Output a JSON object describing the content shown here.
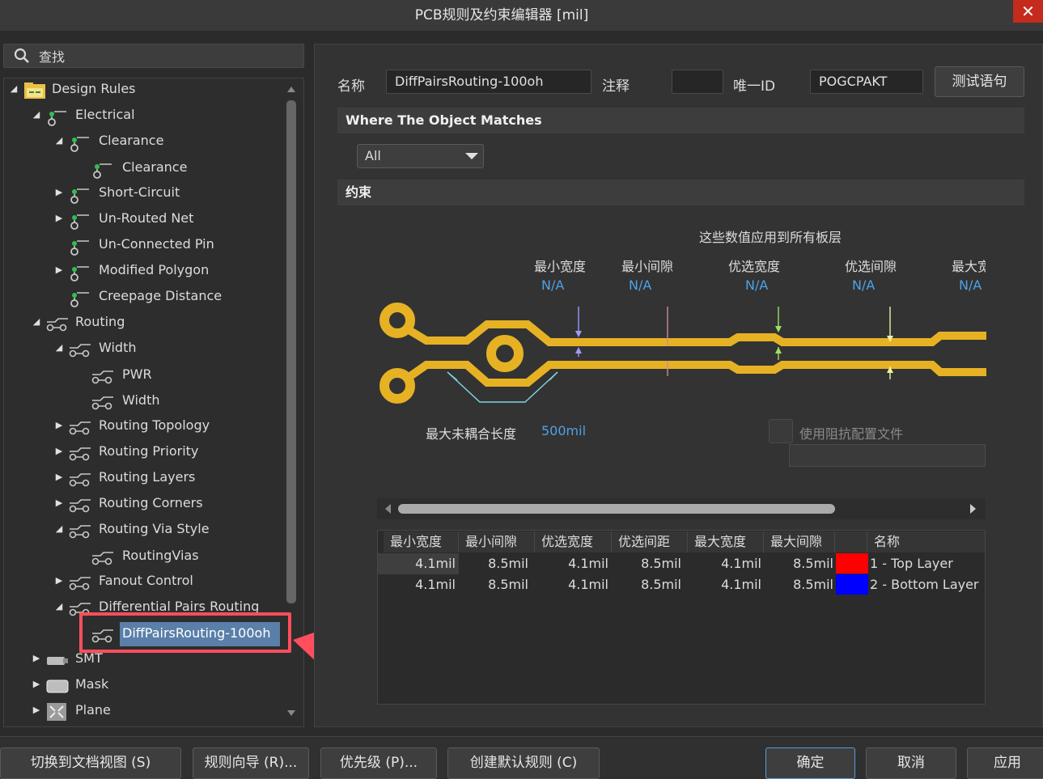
{
  "window": {
    "title": "PCB规则及约束编辑器 [mil]",
    "close_glyph": "✕"
  },
  "search": {
    "label": "查找"
  },
  "tree": {
    "items": [
      {
        "label": "Design Rules",
        "arrow": "◢",
        "icon": "design-rules-folder-icon"
      },
      {
        "label": "Electrical",
        "arrow": "◢",
        "icon": "electrical-rule-icon"
      },
      {
        "label": "Clearance",
        "arrow": "◢",
        "icon": "electrical-rule-icon"
      },
      {
        "label": "Clearance",
        "arrow": "",
        "icon": "electrical-rule-icon"
      },
      {
        "label": "Short-Circuit",
        "arrow": "▶",
        "icon": "electrical-rule-icon"
      },
      {
        "label": "Un-Routed Net",
        "arrow": "▶",
        "icon": "electrical-rule-icon"
      },
      {
        "label": "Un-Connected Pin",
        "arrow": "",
        "icon": "electrical-rule-icon"
      },
      {
        "label": "Modified Polygon",
        "arrow": "▶",
        "icon": "electrical-rule-icon"
      },
      {
        "label": "Creepage Distance",
        "arrow": "",
        "icon": "electrical-rule-icon"
      },
      {
        "label": "Routing",
        "arrow": "◢",
        "icon": "routing-rule-icon"
      },
      {
        "label": "Width",
        "arrow": "◢",
        "icon": "routing-rule-icon"
      },
      {
        "label": "PWR",
        "arrow": "",
        "icon": "routing-rule-icon"
      },
      {
        "label": "Width",
        "arrow": "",
        "icon": "routing-rule-icon"
      },
      {
        "label": "Routing Topology",
        "arrow": "▶",
        "icon": "routing-rule-icon"
      },
      {
        "label": "Routing Priority",
        "arrow": "▶",
        "icon": "routing-rule-icon"
      },
      {
        "label": "Routing Layers",
        "arrow": "▶",
        "icon": "routing-rule-icon"
      },
      {
        "label": "Routing Corners",
        "arrow": "▶",
        "icon": "routing-rule-icon"
      },
      {
        "label": "Routing Via Style",
        "arrow": "◢",
        "icon": "routing-rule-icon"
      },
      {
        "label": "RoutingVias",
        "arrow": "",
        "icon": "routing-rule-icon"
      },
      {
        "label": "Fanout Control",
        "arrow": "▶",
        "icon": "routing-rule-icon"
      },
      {
        "label": "Differential Pairs Routing",
        "arrow": "◢",
        "icon": "routing-rule-icon"
      },
      {
        "label": "DiffPairsRouting-100oh",
        "arrow": "",
        "icon": "routing-rule-icon"
      },
      {
        "label": "SMT",
        "arrow": "▶",
        "icon": "smt-rule-icon"
      },
      {
        "label": "Mask",
        "arrow": "▶",
        "icon": "mask-rule-icon"
      },
      {
        "label": "Plane",
        "arrow": "▶",
        "icon": "plane-rule-icon"
      }
    ]
  },
  "rule": {
    "name_label": "名称",
    "name_value": "DiffPairsRouting-100oh",
    "comment_label": "注释",
    "comment_value": "",
    "uid_label": "唯一ID",
    "uid_value": "POGCPAKT",
    "test_button": "测试语句"
  },
  "where": {
    "header": "Where The Object Matches",
    "scope_value": "All"
  },
  "constraints": {
    "header": "约束",
    "applies_to_all": "这些数值应用到所有板层",
    "columns": [
      {
        "label": "最小宽度",
        "value": "N/A"
      },
      {
        "label": "最小间隙",
        "value": "N/A"
      },
      {
        "label": "优选宽度",
        "value": "N/A"
      },
      {
        "label": "优选间隙",
        "value": "N/A"
      },
      {
        "label": "最大宽",
        "value": "N/A"
      }
    ],
    "max_uncoupled_label": "最大未耦合长度",
    "max_uncoupled_value": "500mil",
    "impedance_label": "使用阻抗配置文件",
    "trace_color": "#e6b224"
  },
  "grid": {
    "headers": [
      "最小宽度",
      "最小间隙",
      "优选宽度",
      "优选间距",
      "最大宽度",
      "最大间隙",
      "",
      "名称"
    ],
    "rows": [
      {
        "cells": [
          "4.1mil",
          "8.5mil",
          "4.1mil",
          "8.5mil",
          "4.1mil",
          "8.5mil"
        ],
        "color": "#ff0000",
        "name": "1 - Top Layer"
      },
      {
        "cells": [
          "4.1mil",
          "8.5mil",
          "4.1mil",
          "8.5mil",
          "4.1mil",
          "8.5mil"
        ],
        "color": "#0000ff",
        "name": "2 - Bottom Layer"
      }
    ]
  },
  "footer": {
    "doc_view": "切换到文档视图 (S)",
    "wizard": "规则向导 (R)...",
    "priority": "优先级 (P)...",
    "create_defaults": "创建默认规则 (C)",
    "ok": "确定",
    "cancel": "取消",
    "apply": "应用"
  }
}
